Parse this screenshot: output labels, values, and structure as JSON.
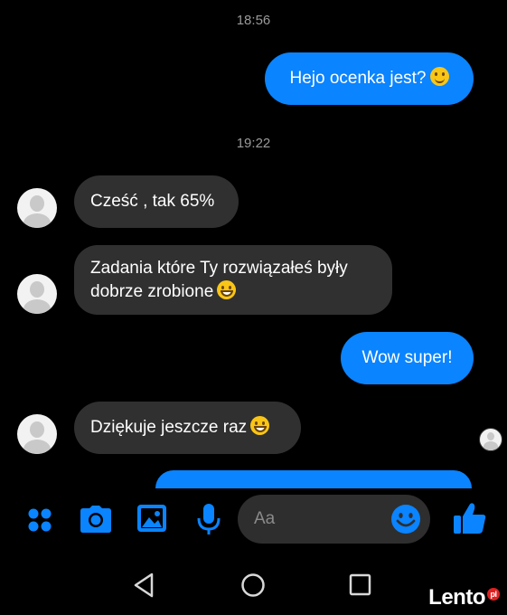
{
  "conversation": {
    "timestamp_1": "18:56",
    "msg_out_1": "Hejo ocenka jest?",
    "timestamp_2": "19:22",
    "msg_in_1": "Cześć , tak 65%",
    "msg_in_2_line1": "Zadania które Ty rozwiązałeś były",
    "msg_in_2_line2": "dobrze zrobione",
    "msg_out_2": "Wow super!",
    "msg_in_3": "Dziękuje jeszcze raz"
  },
  "composer": {
    "placeholder": "Aa"
  },
  "colors": {
    "accent": "#0a84ff",
    "incoming_bubble": "#303030",
    "background": "#000000"
  },
  "watermark": {
    "brand": "Lento",
    "suffix": "pl"
  }
}
